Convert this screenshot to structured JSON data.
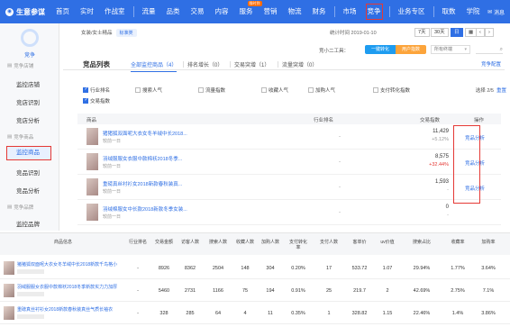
{
  "topnav": {
    "logo": "生意参谋",
    "items": [
      {
        "label": "首页"
      },
      {
        "label": "实时"
      },
      {
        "label": "作战室"
      },
      {
        "label": "流量"
      },
      {
        "label": "品类"
      },
      {
        "label": "交易"
      },
      {
        "label": "内容"
      },
      {
        "label": "服务",
        "badge": "限时到"
      },
      {
        "label": "营销"
      },
      {
        "label": "物流"
      },
      {
        "label": "财务"
      }
    ],
    "right_items": [
      {
        "label": "市场"
      },
      {
        "label": "竞争"
      },
      {
        "label": "业务专区"
      },
      {
        "label": "取数"
      },
      {
        "label": "学院"
      }
    ],
    "msg": "消息",
    "colors": {
      "nav_bg": "#2f6fe4",
      "highlight": "#e53935"
    }
  },
  "sidebar": {
    "title": "竞争",
    "groups": [
      {
        "label": "竞争店铺",
        "items": [
          "监控店铺",
          "竞店识别",
          "竞店分析"
        ]
      },
      {
        "label": "竞争商品",
        "items": [
          "监控商品",
          "竞品识别",
          "竞品分析"
        ]
      },
      {
        "label": "竞争品牌",
        "items": [
          "监控品牌"
        ]
      }
    ],
    "active": "监控商品"
  },
  "header": {
    "breadcrumb": "女装/女士精品",
    "category_tag": "标准类",
    "stat_time": "统计时间 2019-01-10",
    "range_buttons": [
      "7天",
      "30天",
      "日"
    ],
    "tool_label": "竞小二工具：",
    "seg_one": "一键转化",
    "seg_two": "用户指数",
    "select_placeholder": "所有终端",
    "search_icon": "search-icon"
  },
  "tabs": {
    "title": "竞品列表",
    "items": [
      "全部监控商品（4）",
      "排名增长（0）",
      "交易突增（1）",
      "流量突增（0）"
    ],
    "corner_link": "竞争配置"
  },
  "filters": {
    "items": [
      {
        "label": "行业排名",
        "checked": true
      },
      {
        "label": "搜索人气",
        "checked": false
      },
      {
        "label": "流量指数",
        "checked": false
      },
      {
        "label": "收藏人气",
        "checked": false
      },
      {
        "label": "加购人气",
        "checked": false
      },
      {
        "label": "支付转化指数",
        "checked": false
      },
      {
        "label": "交易指数",
        "checked": true
      }
    ],
    "selected_text": "选择 2/5",
    "reset_label": "重置"
  },
  "table": {
    "headers": [
      "商品",
      "行业排名",
      "交易指数",
      "操作"
    ],
    "rows": [
      {
        "name": "猪猪狐双面呢大衣女冬羊绒中长2018...",
        "date": "较前一日",
        "rank": "-",
        "index": "11,429",
        "change": "+5.12%",
        "change_type": "up",
        "action": "竞品分析"
      },
      {
        "name": "羽绒服服女衣服中款棉袄2018冬季...",
        "date": "较前一日",
        "rank": "-",
        "index": "8,575",
        "change": "+32.44%",
        "change_type": "red",
        "action": "竞品分析"
      },
      {
        "name": "重磅真丝衬衫女2018新款春秋装真...",
        "date": "较前一日",
        "rank": "-",
        "index": "1,593",
        "change": "-",
        "change_type": "up",
        "action": "竞品分析"
      },
      {
        "name": "羽绒棉服女中长款2018新款冬季女装...",
        "date": "较前一日",
        "rank": "-",
        "index": "0",
        "change": "-",
        "change_type": "up",
        "action": ""
      }
    ]
  },
  "bottom_table": {
    "headers": [
      "商品信息",
      "行业排名",
      "交易金额",
      "访客人数",
      "搜索人数",
      "收藏人数",
      "加购人数",
      "支付转化率",
      "支付人数",
      "客单价",
      "uv价值",
      "搜索占比",
      "收藏率",
      "加购率"
    ],
    "rows": [
      {
        "name": "猪猪狐双面呢大衣女冬羊绒中长2018新款千鸟格小",
        "cells": [
          "-",
          "8926",
          "8362",
          "2504",
          "148",
          "304",
          "0.20%",
          "17",
          "533.72",
          "1.07",
          "29.94%",
          "1.77%",
          "3.64%"
        ]
      },
      {
        "name": "羽绒服服女衣服中款棉袄2018冬季新款实力力加厚",
        "cells": [
          "-",
          "5460",
          "2731",
          "1166",
          "75",
          "194",
          "0.91%",
          "25",
          "219.7",
          "2",
          "42.69%",
          "2.75%",
          "7.1%"
        ]
      },
      {
        "name": "重磅真丝衬衫女2018新款春秋装真丝气质长袖衣",
        "cells": [
          "-",
          "328",
          "285",
          "64",
          "4",
          "11",
          "0.35%",
          "1",
          "328.82",
          "1.15",
          "22.46%",
          "1.4%",
          "3.86%"
        ]
      }
    ]
  }
}
